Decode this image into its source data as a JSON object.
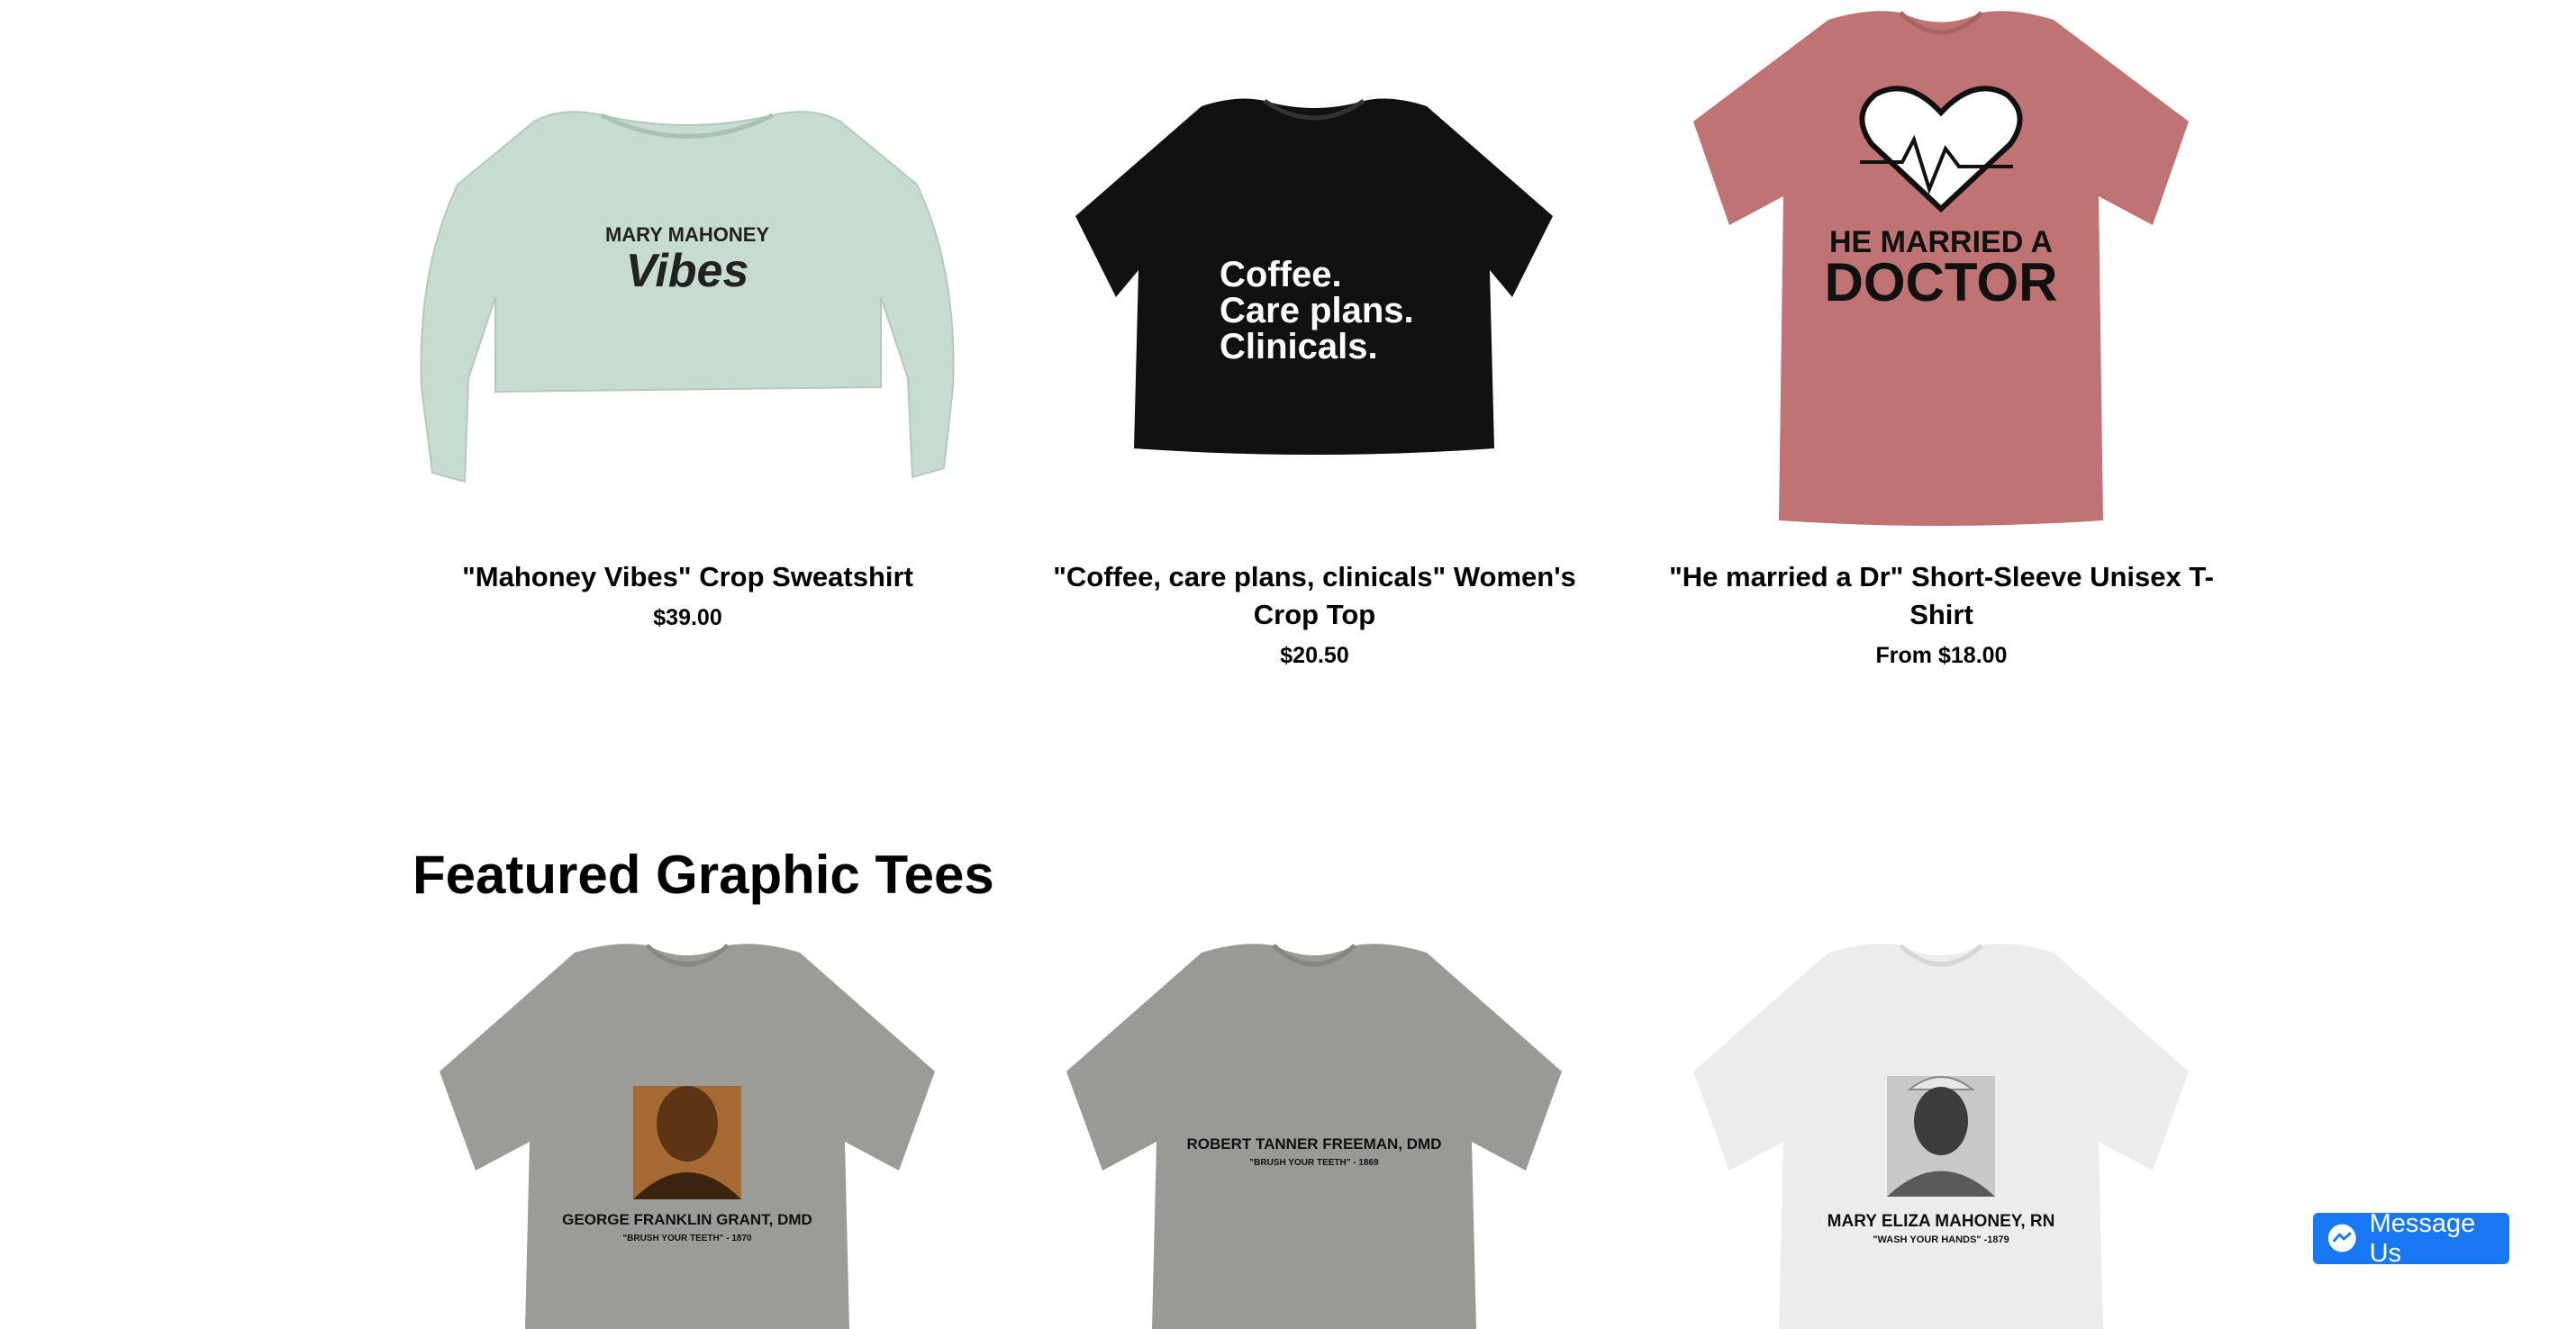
{
  "products": [
    {
      "title": "\"Mahoney Vibes\" Crop Sweatshirt",
      "price": "$39.00",
      "print_line1": "MARY MAHONEY",
      "print_line2": "Vibes"
    },
    {
      "title": "\"Coffee, care plans, clinicals\" Women's Crop Top",
      "price": "$20.50",
      "print_line1": "Coffee.",
      "print_line2": "Care plans.",
      "print_line3": "Clinicals."
    },
    {
      "title": "\"He married a Dr\" Short-Sleeve Unisex T-Shirt",
      "price": "From $18.00",
      "print_line1": "HE MARRIED A",
      "print_line2": "DOCTOR"
    }
  ],
  "featured": {
    "heading": "Featured Graphic Tees",
    "items": [
      {
        "print_name": "GEORGE FRANKLIN GRANT, DMD",
        "print_quote": "\"BRUSH YOUR TEETH\" - 1870"
      },
      {
        "print_name": "ROBERT TANNER FREEMAN, DMD",
        "print_quote": "\"BRUSH YOUR TEETH\" - 1869"
      },
      {
        "print_name": "MARY ELIZA MAHONEY, RN",
        "print_quote": "\"WASH YOUR HANDS\" -1879"
      }
    ]
  },
  "messenger": {
    "label": "Message Us",
    "icon": "messenger-icon"
  },
  "colors": {
    "sage": "#c5dccf",
    "black_tee": "#111111",
    "mauve": "#c07373",
    "grey_tee": "#9b9b98",
    "white_tee": "#ececea",
    "messenger_blue": "#1877f2"
  }
}
